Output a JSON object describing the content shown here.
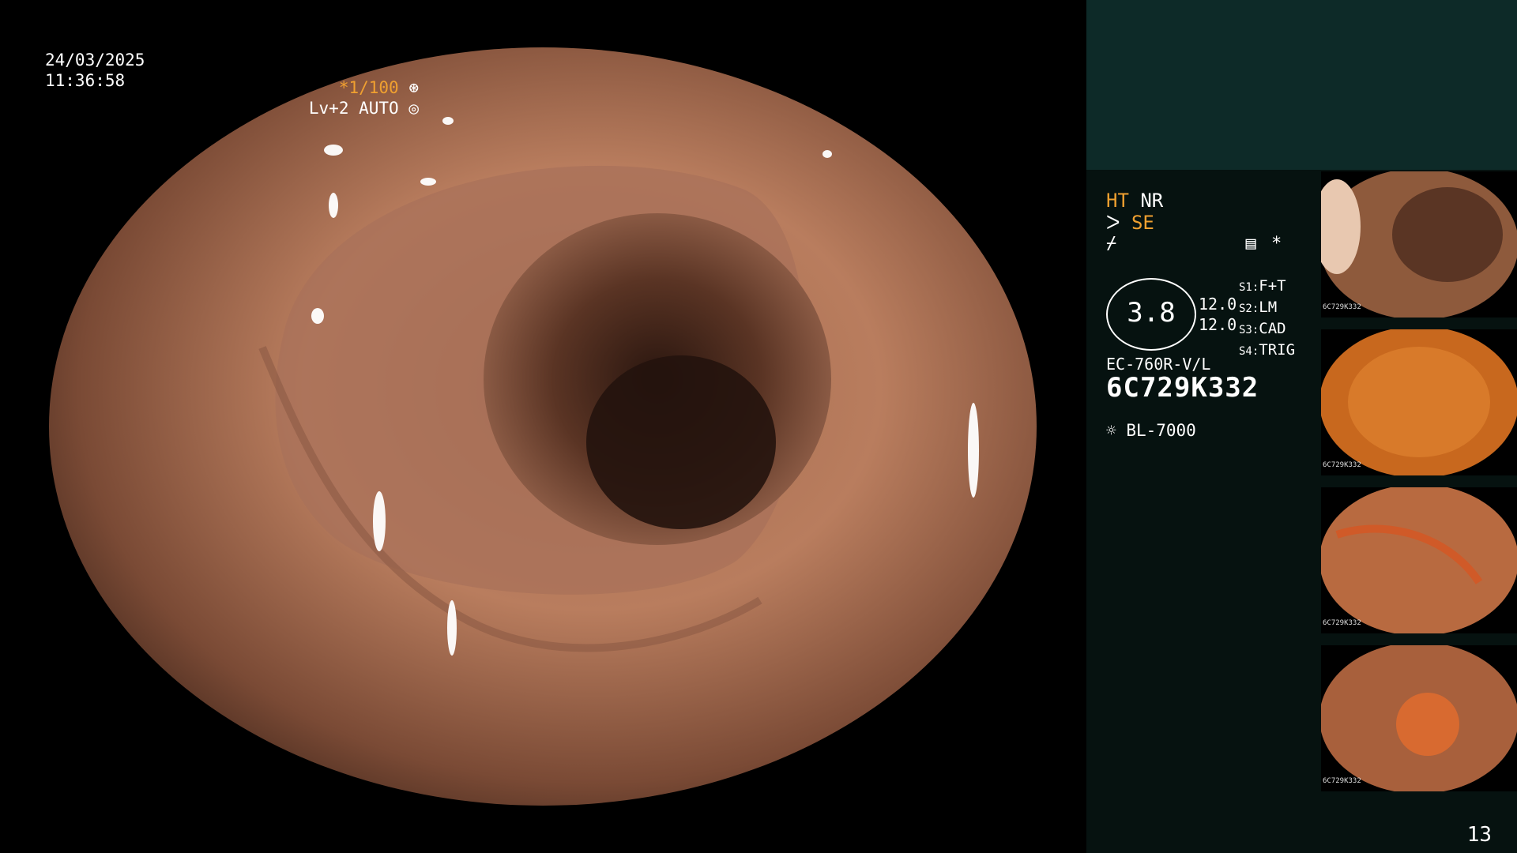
{
  "osd": {
    "date": "24/03/2025",
    "time": "11:36:58",
    "shutter": "*1/100",
    "level": "Lv+2 AUTO"
  },
  "status": {
    "ht": "HT",
    "nr": "NR",
    "se": "SE",
    "star": "*",
    "gauge_value": "3.8",
    "values": [
      "12.0",
      "12.0"
    ],
    "s_labels": [
      "S1:",
      "S2:",
      "S3:",
      "S4:"
    ],
    "s_values": [
      "F+T",
      "LM",
      "CAD",
      "TRIG"
    ],
    "scope_model": "EC-760R-V/L",
    "serial": "6C729K332",
    "light_source": "BL-7000"
  },
  "thumbnails": [
    {
      "id": "6C729K332"
    },
    {
      "id": "6C729K332"
    },
    {
      "id": "6C729K332"
    },
    {
      "id": "6C729K332"
    }
  ],
  "page_number": "13"
}
